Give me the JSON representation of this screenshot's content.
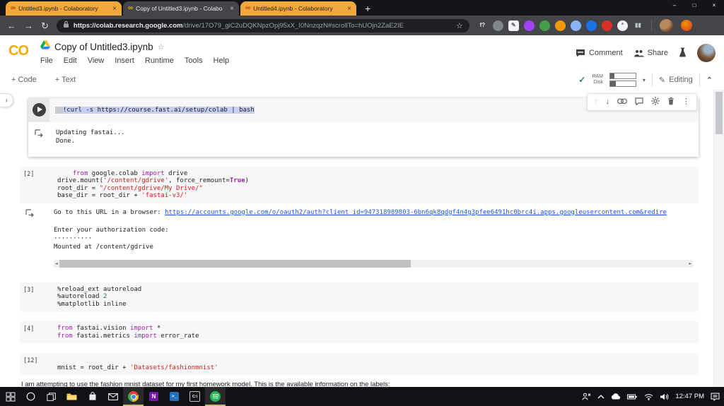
{
  "browser": {
    "tabs": [
      {
        "title": "Untitled3.ipynb - Colaboratory",
        "active": false
      },
      {
        "title": "Copy of Untitled3.ipynb - Colabo",
        "active": true
      },
      {
        "title": "Untitled4.ipynb - Colaboratory",
        "active": false
      }
    ],
    "url_domain": "https://colab.research.google.com",
    "url_path": "/drive/17O79_giC2uDQKNpzOpj95xX_I0NnzqzN#scrollTo=hUOjn2ZaE2IE",
    "extensions": [
      {
        "name": "function-extension-icon",
        "glyph": "f?",
        "bg": "transparent",
        "fg": "#E8EAED"
      },
      {
        "name": "gray-extension-icon",
        "glyph": "",
        "bg": "#80868B",
        "fg": "#FFFFFF"
      },
      {
        "name": "pen-extension-icon",
        "glyph": "✎",
        "bg": "#F1F3F4",
        "fg": "#5F6368",
        "square": true
      },
      {
        "name": "purple-extension-icon",
        "glyph": "",
        "bg": "#A142F4",
        "fg": "#FFFFFF"
      },
      {
        "name": "green-hexagon-extension-icon",
        "glyph": "",
        "bg": "#43A047",
        "fg": "#FFFFFF"
      },
      {
        "name": "orange-extension-icon",
        "glyph": "",
        "bg": "#F29900",
        "fg": "#FFFFFF"
      },
      {
        "name": "blue-circle-extension-icon",
        "glyph": "",
        "bg": "#8AB4F8",
        "fg": "#FFFFFF"
      },
      {
        "name": "shield-extension-icon",
        "glyph": "",
        "bg": "#1A73E8",
        "fg": "#FFFFFF"
      },
      {
        "name": "red-hand-extension-icon",
        "glyph": "",
        "bg": "#D93025",
        "fg": "#FFFFFF"
      },
      {
        "name": "atom-extension-icon",
        "glyph": "*",
        "bg": "#F1F3F4",
        "fg": "#5F6368"
      },
      {
        "name": "books-extension-icon",
        "glyph": "▮▮",
        "bg": "transparent",
        "fg": "#BDC1C6"
      }
    ]
  },
  "colab": {
    "logo": "CO",
    "title": "Copy of Untitled3.ipynb",
    "menus": [
      "File",
      "Edit",
      "View",
      "Insert",
      "Runtime",
      "Tools",
      "Help"
    ],
    "comment_label": "Comment",
    "share_label": "Share",
    "add_code_label": "+ Code",
    "add_text_label": "+ Text",
    "ram_label": "RAM",
    "disk_label": "Disk",
    "editing_label": "Editing"
  },
  "notebook": {
    "cells": [
      {
        "focused": true,
        "code_lines": [
          [
            {
              "c": "wssel",
              "t": "  "
            },
            {
              "c": "sel",
              "t": "!curl -s https://course.fast.ai/setup/colab | bash"
            }
          ]
        ],
        "output": [
          {
            "kind": "text",
            "t": "Updating fastai..."
          },
          {
            "kind": "text",
            "t": "Done."
          }
        ]
      },
      {
        "exec_label": "[2]",
        "code_lines": [
          [
            {
              "c": "p",
              "t": "    "
            },
            {
              "c": "kw",
              "t": "from"
            },
            {
              "c": "p",
              "t": " google.colab "
            },
            {
              "c": "kw",
              "t": "import"
            },
            {
              "c": "p",
              "t": " drive"
            }
          ],
          [
            {
              "c": "p",
              "t": "drive.mount("
            },
            {
              "c": "str",
              "t": "'/content/gdrive'"
            },
            {
              "c": "p",
              "t": ", force_remount="
            },
            {
              "c": "bool",
              "t": "True"
            },
            {
              "c": "p",
              "t": ")"
            }
          ],
          [
            {
              "c": "p",
              "t": "root_dir = "
            },
            {
              "c": "str",
              "t": "\"/content/gdrive/My Drive/\""
            }
          ],
          [
            {
              "c": "p",
              "t": "base_dir = root_dir + "
            },
            {
              "c": "str",
              "t": "'fastai-v3/'"
            }
          ]
        ],
        "output": [
          {
            "kind": "link",
            "prefix": "Go to this URL in a browser: ",
            "link": "https://accounts.google.com/o/oauth2/auth?client_id=947318989803-6bn6qk8qdgf4n4g3pfee6491hc0brc4i.apps.googleusercontent.com&redire"
          },
          {
            "kind": "gap"
          },
          {
            "kind": "text",
            "t": "Enter your authorization code:"
          },
          {
            "kind": "text",
            "t": "··········"
          },
          {
            "kind": "text",
            "t": "Mounted at /content/gdrive"
          },
          {
            "kind": "hscroll"
          }
        ]
      },
      {
        "exec_label": "[3]",
        "code_lines": [
          [
            {
              "c": "p",
              "t": "%reload_ext autoreload"
            }
          ],
          [
            {
              "c": "p",
              "t": "%autoreload "
            },
            {
              "c": "num",
              "t": "2"
            }
          ],
          [
            {
              "c": "p",
              "t": "%matplotlib inline"
            }
          ]
        ]
      },
      {
        "exec_label": "[4]",
        "code_lines": [
          [
            {
              "c": "kw",
              "t": "from"
            },
            {
              "c": "p",
              "t": " fastai.vision "
            },
            {
              "c": "kw",
              "t": "import"
            },
            {
              "c": "p",
              "t": " *"
            }
          ],
          [
            {
              "c": "kw",
              "t": "from"
            },
            {
              "c": "p",
              "t": " fastai.metrics "
            },
            {
              "c": "kw",
              "t": "import"
            },
            {
              "c": "p",
              "t": " error_rate"
            }
          ]
        ]
      },
      {
        "exec_label": "[12]",
        "code_lines": [
          [],
          [
            {
              "c": "p",
              "t": "mnist = root_dir + "
            },
            {
              "c": "str",
              "t": "'Datasets/fashionmnist'"
            }
          ]
        ]
      }
    ],
    "text_cell": "I am attempting to use the fashion mnist dataset for my first homework model. This is the available information on the labels:"
  },
  "taskbar": {
    "items": [
      {
        "name": "start-button",
        "kind": "start"
      },
      {
        "name": "search-button",
        "kind": "search"
      },
      {
        "name": "task-view-button",
        "kind": "taskview"
      },
      {
        "name": "file-explorer-icon",
        "kind": "explorer"
      },
      {
        "name": "microsoft-store-icon",
        "kind": "store"
      },
      {
        "name": "mail-icon",
        "kind": "mail"
      },
      {
        "name": "chrome-icon",
        "kind": "chrome",
        "active": true
      },
      {
        "name": "onenote-icon",
        "kind": "sq",
        "glyph": "N",
        "color": "#7719AA",
        "fs": 8
      },
      {
        "name": "powershell-icon",
        "kind": "sq",
        "glyph": ">_",
        "color": "#2671BE",
        "fs": 6.5
      },
      {
        "name": "cmd-icon",
        "kind": "sq",
        "glyph": "C:\\",
        "color": "#18181B",
        "border": "#BDBDBD",
        "fs": 5.5
      },
      {
        "name": "spotify-icon",
        "kind": "spotify",
        "active": true
      }
    ],
    "time": "12:47 PM"
  },
  "colors": {
    "tab_yellow": "#F2A93B",
    "colab_brand": "#F9AB00",
    "keyword": "#A31DAD",
    "string": "#C5221F",
    "number": "#188038",
    "link": "#1A56DB",
    "selection": "#C7CFF2",
    "status_check_green": "#1E8E3E"
  }
}
